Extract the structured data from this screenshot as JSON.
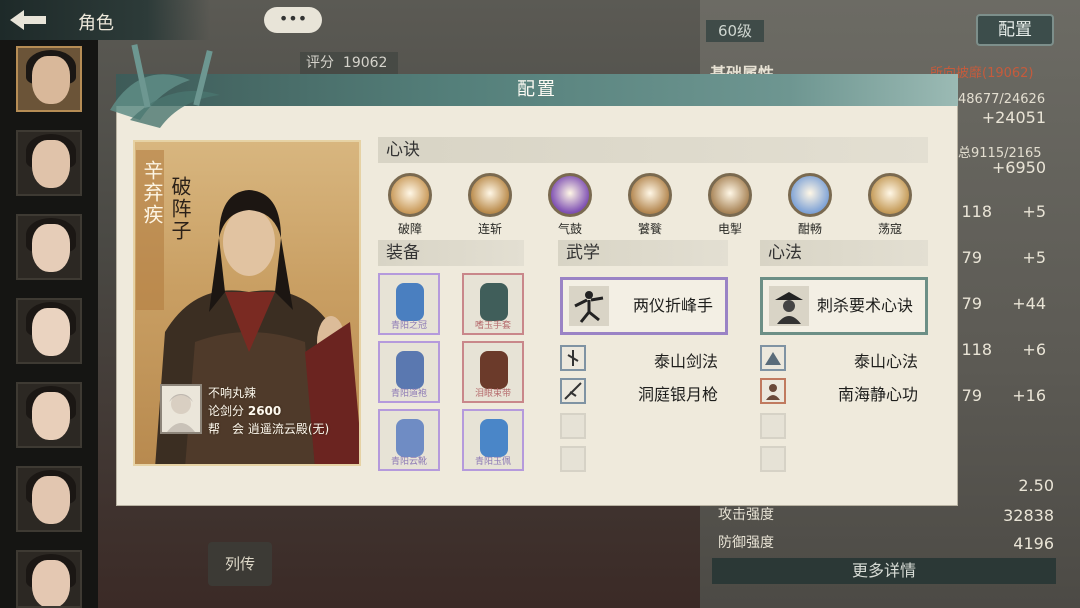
{
  "topbar": {
    "title": "角色",
    "more": "•••"
  },
  "background": {
    "score_label": "评分",
    "score_value": "19062",
    "level": "60级",
    "config_button": "配置",
    "section_title": "基础属性",
    "equip_status": "所向披靡(19062)",
    "stats": [
      {
        "label": "",
        "value": "+24051",
        "sub": "48677/24626"
      },
      {
        "label": "",
        "value": "+6950",
        "sub": "总9115/2165"
      },
      {
        "label": "",
        "value": "+5",
        "sub": "118"
      },
      {
        "label": "",
        "value": "+5",
        "sub": "79"
      },
      {
        "label": "",
        "value": "+44",
        "sub": "79"
      },
      {
        "label": "",
        "value": "+6",
        "sub": "118"
      },
      {
        "label": "",
        "value": "+16",
        "sub": "79"
      }
    ],
    "bottom_stats": [
      {
        "label": "",
        "value": "2.50"
      },
      {
        "label": "攻击强度",
        "value": "32838"
      },
      {
        "label": "防御强度",
        "value": "4196"
      }
    ],
    "more_details": "更多详情",
    "liezhuan": "列传"
  },
  "modal": {
    "title": "配置",
    "character": {
      "name": "辛弃疾",
      "title": "破阵子"
    },
    "player": {
      "name": "不响丸辣",
      "score_label": "论剑分",
      "score": "2600",
      "guild_label": "帮　会",
      "guild": "逍遥流云殿(无)"
    },
    "sections": {
      "xinjue": "心诀",
      "equipment": "装备",
      "wuxue": "武学",
      "xinfa": "心法"
    },
    "xinjue_skills": [
      {
        "name": "破障",
        "color": "#c99a5a"
      },
      {
        "name": "连斩",
        "color": "#b98a4a"
      },
      {
        "name": "气鼓",
        "color": "#7e4fb3"
      },
      {
        "name": "饕餮",
        "color": "#b3864f"
      },
      {
        "name": "电掣",
        "color": "#a88457"
      },
      {
        "name": "酣畅",
        "color": "#7ea2d6"
      },
      {
        "name": "荡寇",
        "color": "#c49a57"
      }
    ],
    "equipment": [
      {
        "name": "青阳之冠",
        "color": "#4a7fc0",
        "rarity": "purple"
      },
      {
        "name": "嗜玉手套",
        "color": "#405e5a",
        "rarity": "red"
      },
      {
        "name": "青阳道袍",
        "color": "#5a78b0",
        "rarity": "purple"
      },
      {
        "name": "泪眼束带",
        "color": "#6b3a2a",
        "rarity": "red"
      },
      {
        "name": "青阳云靴",
        "color": "#6f8cc4",
        "rarity": "purple"
      },
      {
        "name": "青阳玉佩",
        "color": "#4a86c8",
        "rarity": "purple"
      }
    ],
    "wuxue": {
      "main": "两仪折峰手",
      "list": [
        "泰山剑法",
        "洞庭银月枪"
      ]
    },
    "xinfa": {
      "main": "刺杀要术心诀",
      "list": [
        "泰山心法",
        "南海静心功"
      ]
    }
  }
}
